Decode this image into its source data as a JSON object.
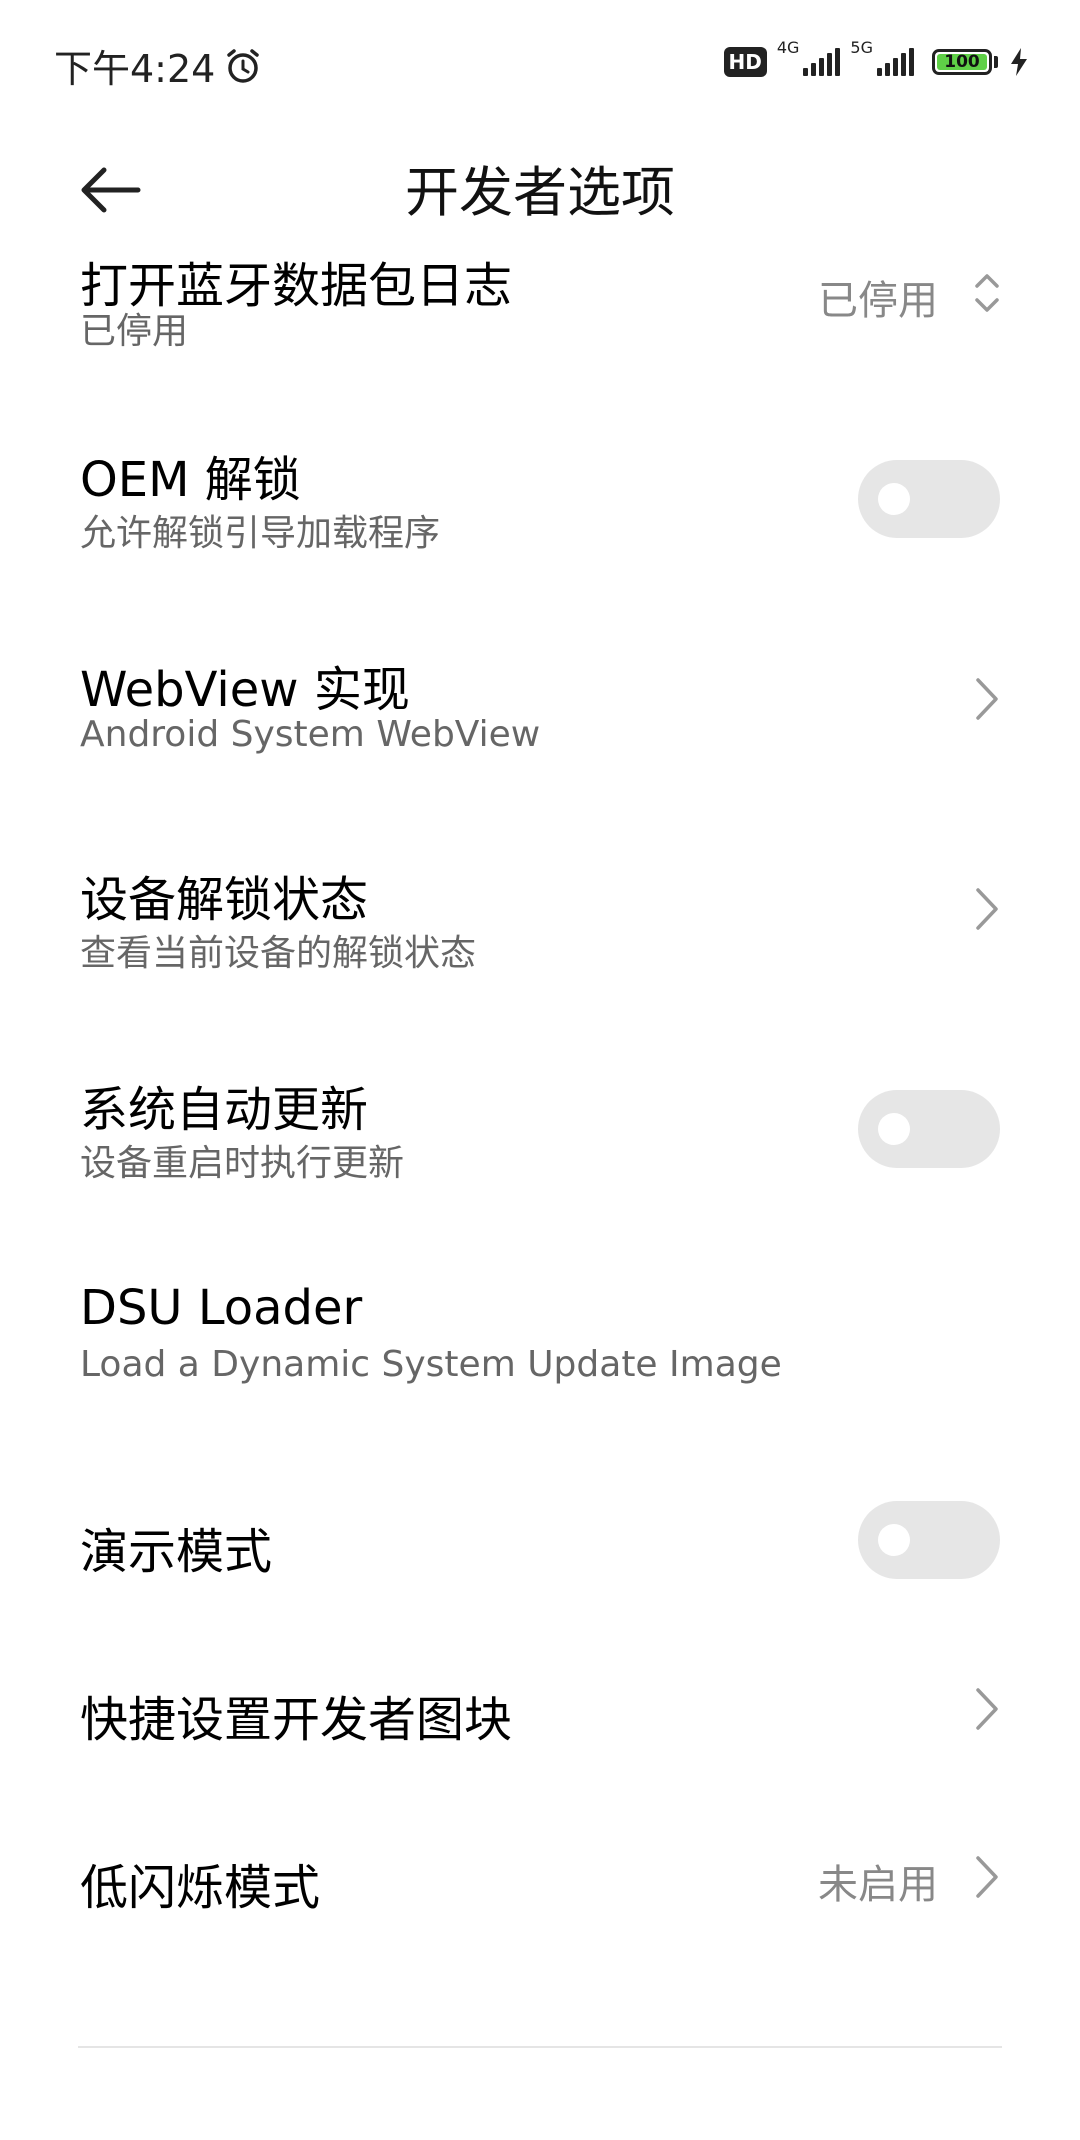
{
  "status_bar": {
    "time": "下午4:24",
    "hd_label": "HD",
    "network_1": "4G",
    "network_2": "5G",
    "battery": "100"
  },
  "header": {
    "title": "开发者选项"
  },
  "rows": [
    {
      "title": "打开蓝牙数据包日志",
      "subtitle": "已停用",
      "value": "已停用",
      "control": "dropdown"
    },
    {
      "title": "OEM 解锁",
      "subtitle": "允许解锁引导加载程序",
      "control": "toggle",
      "enabled": false
    },
    {
      "title": "WebView 实现",
      "subtitle": "Android System WebView",
      "control": "chevron"
    },
    {
      "title": "设备解锁状态",
      "subtitle": "查看当前设备的解锁状态",
      "control": "chevron"
    },
    {
      "title": "系统自动更新",
      "subtitle": "设备重启时执行更新",
      "control": "toggle",
      "enabled": false
    },
    {
      "title": "DSU Loader",
      "subtitle": "Load a Dynamic System Update Image",
      "control": "none"
    },
    {
      "title": "演示模式",
      "control": "toggle",
      "enabled": false
    },
    {
      "title": "快捷设置开发者图块",
      "control": "chevron"
    },
    {
      "title": "低闪烁模式",
      "value": "未启用",
      "control": "chevron"
    }
  ],
  "colors": {
    "toggle_off": "#e6e6e6",
    "battery_fill": "#5fd047",
    "secondary_text": "#666666"
  }
}
